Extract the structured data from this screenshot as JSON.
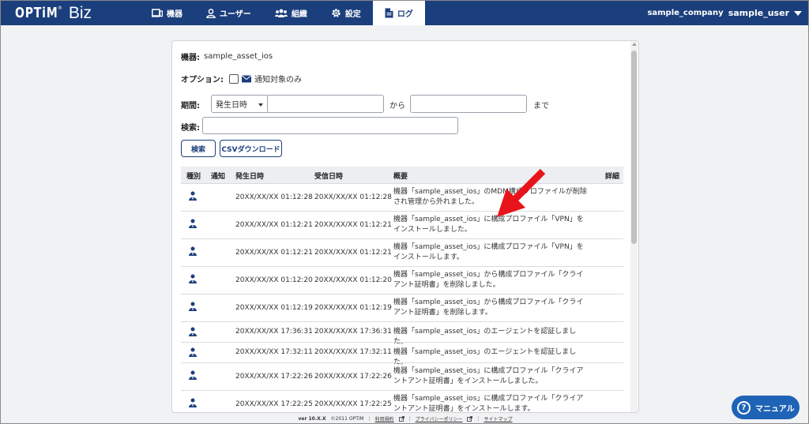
{
  "header": {
    "logo_brand": "OPTiM",
    "logo_tm": "®",
    "logo_product": "Biz",
    "nav": [
      {
        "label": "機器",
        "icon": "device-icon"
      },
      {
        "label": "ユーザー",
        "icon": "user-icon"
      },
      {
        "label": "組織",
        "icon": "organization-icon"
      },
      {
        "label": "設定",
        "icon": "gear-icon"
      },
      {
        "label": "ログ",
        "icon": "log-document-icon",
        "active": true
      }
    ],
    "company": "sample_company",
    "user": "sample_user"
  },
  "filters": {
    "device_label": "機器:",
    "device_value": "sample_asset_ios",
    "option_label": "オプション:",
    "option_checkbox_label": "通知対象のみ",
    "period_label": "期間:",
    "period_select": "発生日時",
    "from_text": "から",
    "to_text": "まで",
    "search_label": "検索:",
    "search_button": "検索",
    "csv_button": "CSVダウンロード"
  },
  "table": {
    "headers": [
      "種別",
      "通知",
      "発生日時",
      "受信日時",
      "概要",
      "詳細"
    ],
    "rows": [
      {
        "occurred": "20XX/XX/XX 01:12:28",
        "received": "20XX/XX/XX 01:12:28",
        "summary": "機器「sample_asset_ios」のMDM構成プロファイルが削除され管理から外れました。"
      },
      {
        "occurred": "20XX/XX/XX 01:12:21",
        "received": "20XX/XX/XX 01:12:21",
        "summary": "機器「sample_asset_ios」に構成プロファイル「VPN」をインストールしました。"
      },
      {
        "occurred": "20XX/XX/XX 01:12:21",
        "received": "20XX/XX/XX 01:12:21",
        "summary": "機器「sample_asset_ios」に構成プロファイル「VPN」をインストールします。"
      },
      {
        "occurred": "20XX/XX/XX 01:12:20",
        "received": "20XX/XX/XX 01:12:20",
        "summary": "機器「sample_asset_ios」から構成プロファイル「クライアント証明書」を削除しました。"
      },
      {
        "occurred": "20XX/XX/XX 01:12:19",
        "received": "20XX/XX/XX 01:12:19",
        "summary": "機器「sample_asset_ios」から構成プロファイル「クライアント証明書」を削除します。"
      },
      {
        "occurred": "20XX/XX/XX 17:36:31",
        "received": "20XX/XX/XX 17:36:31",
        "summary": "機器「sample_asset_ios」のエージェントを認証しました。"
      },
      {
        "occurred": "20XX/XX/XX 17:32:11",
        "received": "20XX/XX/XX 17:32:11",
        "summary": "機器「sample_asset_ios」のエージェントを認証しました。"
      },
      {
        "occurred": "20XX/XX/XX 17:22:26",
        "received": "20XX/XX/XX 17:22:26",
        "summary": "機器「sample_asset_ios」に構成プロファイル「クライアントアント証明書」をインストールしました。"
      },
      {
        "occurred": "20XX/XX/XX 17:22:25",
        "received": "20XX/XX/XX 17:22:25",
        "summary": "機器「sample_asset_ios」に構成プロファイル「クライアントアント証明書」をインストールします。"
      }
    ]
  },
  "footer": {
    "version": "ver 10.X.X",
    "copyright": "©2011 OPTiM",
    "terms": "利用規約",
    "privacy": "プライバシーポリシー",
    "sitemap": "サイトマップ"
  },
  "manual_button": "マニュアル",
  "colors": {
    "header_bg": "#1b3f7c",
    "accent": "#1b3f7c",
    "manual_bg": "#1e63b6",
    "annotation": "#e8141a"
  }
}
